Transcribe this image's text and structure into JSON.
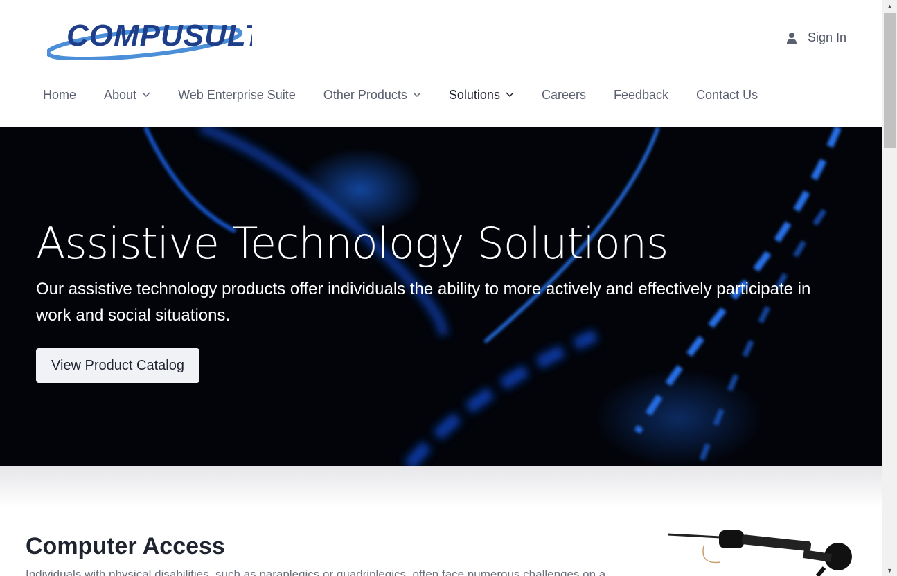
{
  "header": {
    "logo_text": "COMPUSULT",
    "sign_in_label": "Sign In"
  },
  "nav": {
    "items": [
      {
        "label": "Home"
      },
      {
        "label": "About"
      },
      {
        "label": "Web Enterprise Suite"
      },
      {
        "label": "Other Products"
      },
      {
        "label": "Solutions"
      },
      {
        "label": "Careers"
      },
      {
        "label": "Feedback"
      },
      {
        "label": "Contact Us"
      }
    ]
  },
  "hero": {
    "title": "Assistive Technology Solutions",
    "description": "Our assistive technology products offer individuals the ability to more actively and effectively participate in work and social situations.",
    "cta_label": "View Product Catalog"
  },
  "section": {
    "title": "Computer Access",
    "text": "Individuals with physical disabilities, such as paraplegics or quadriplegics, often face numerous challenges on a"
  },
  "colors": {
    "logo_blue": "#1f3e8a",
    "logo_swoosh": "#4a8fd8",
    "hero_bg": "#02040a",
    "hero_glow": "#1a5fd6",
    "nav_text": "#5a6070",
    "nav_active": "#1b1f29"
  },
  "icons": {
    "user": "user-icon",
    "chevron": "chevron-down-icon"
  }
}
